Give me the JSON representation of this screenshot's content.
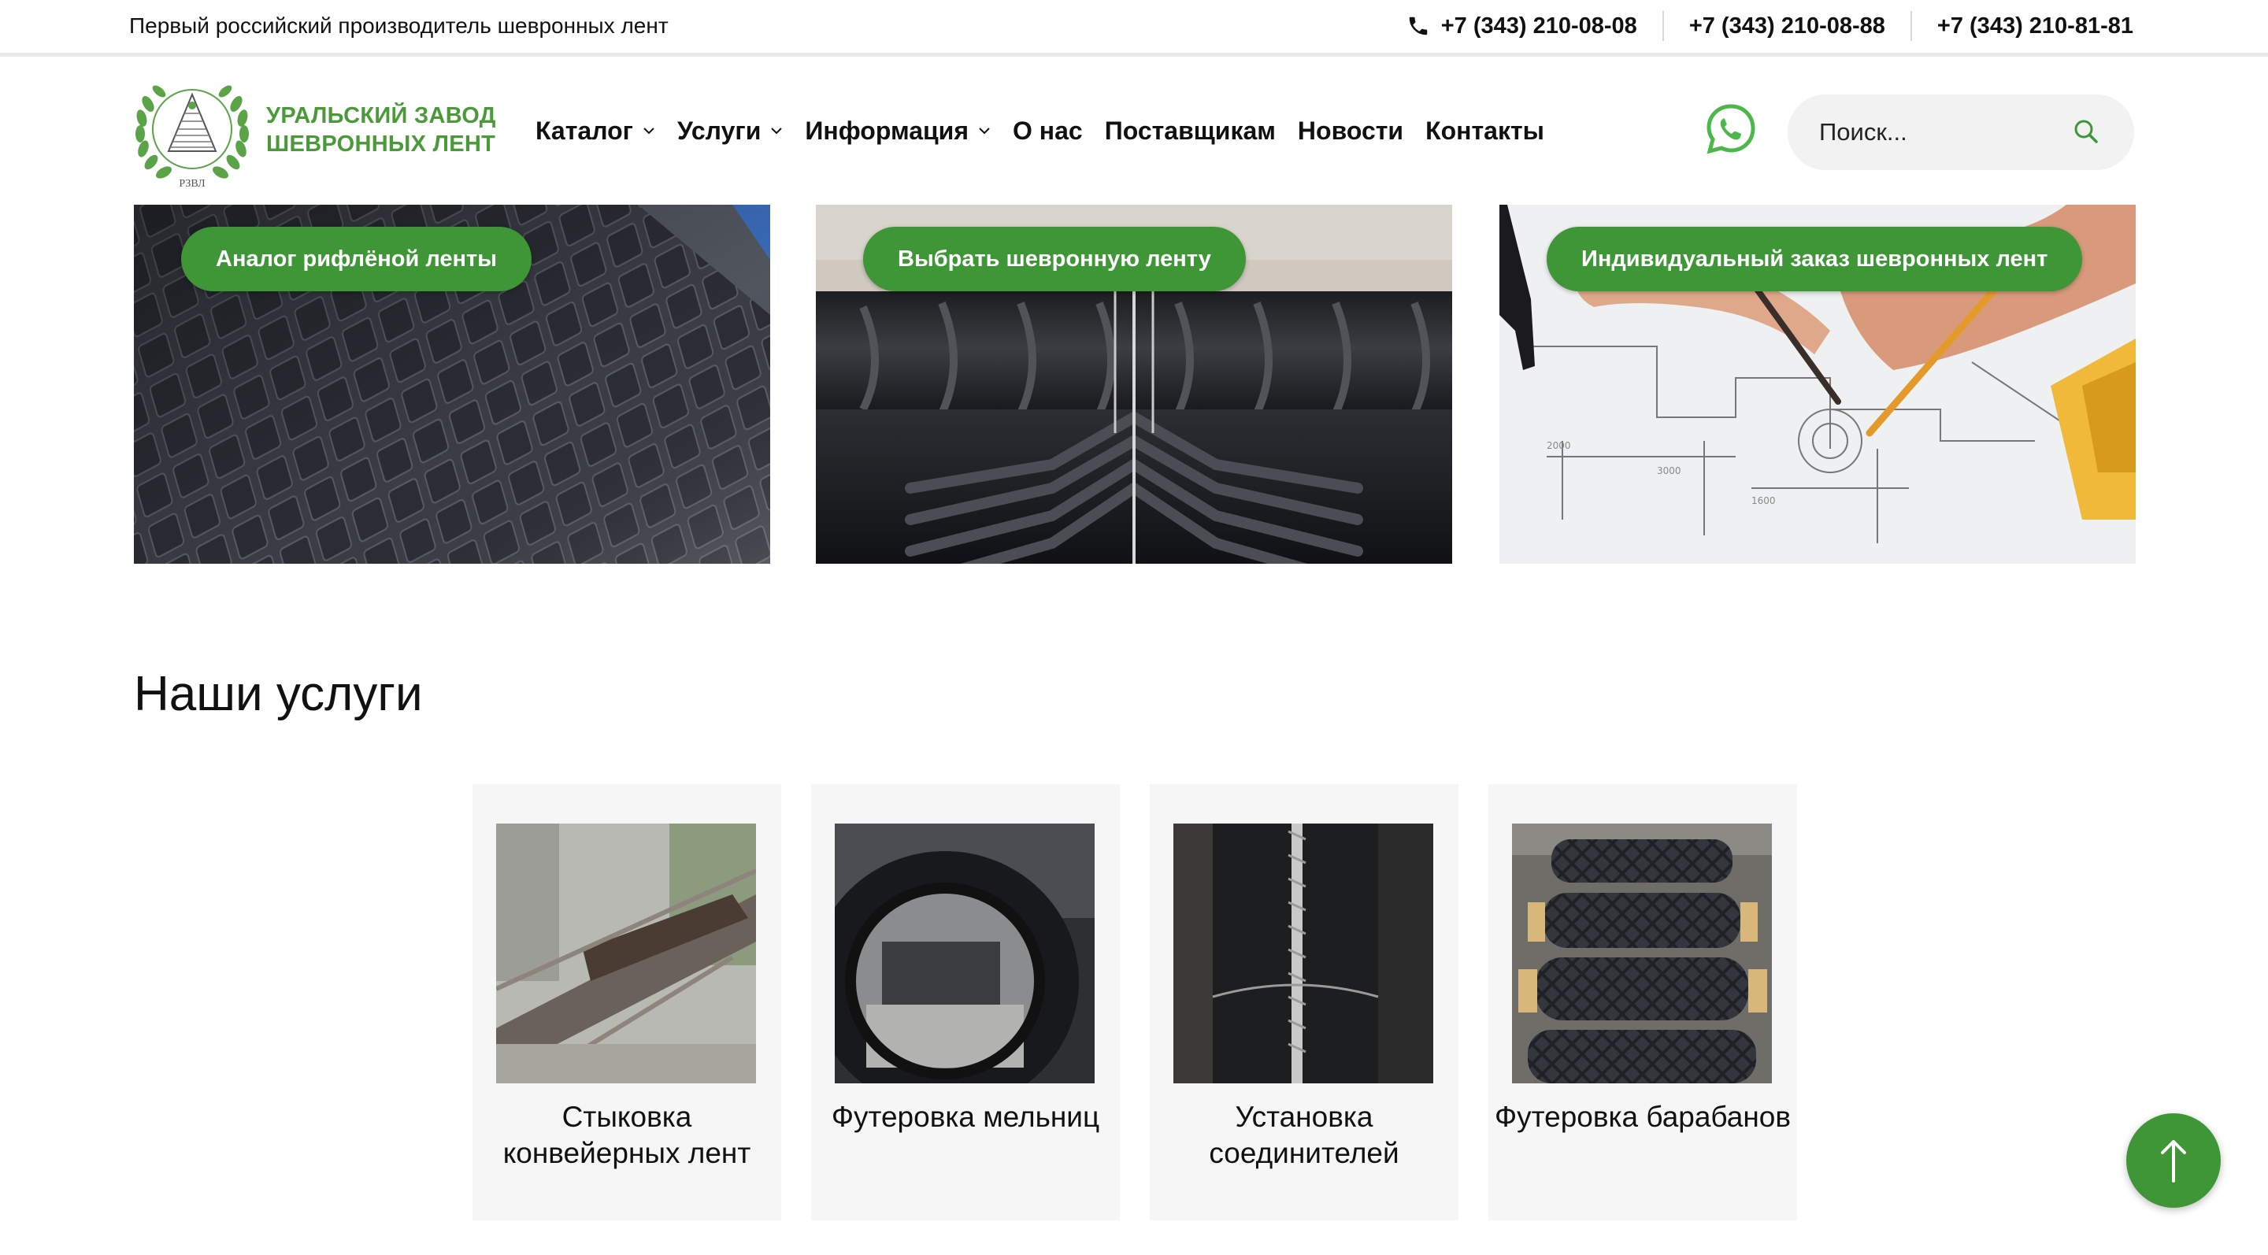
{
  "topbar": {
    "tagline": "Первый российский производитель шевронных лент",
    "phones": [
      "+7 (343) 210-08-08",
      "+7 (343) 210-08-88",
      "+7 (343) 210-81-81"
    ],
    "phone_icon": "phone-icon"
  },
  "brand": {
    "line1": "УРАЛЬСКИЙ ЗАВОД",
    "line2": "ШЕВРОННЫХ ЛЕНТ",
    "logo_monogram": "РЗВЛ",
    "color": "#4a9a3a"
  },
  "nav": {
    "items": [
      {
        "label": "Каталог",
        "has_dropdown": true
      },
      {
        "label": "Услуги",
        "has_dropdown": true
      },
      {
        "label": "Информация",
        "has_dropdown": true
      },
      {
        "label": "О нас",
        "has_dropdown": false
      },
      {
        "label": "Поставщикам",
        "has_dropdown": false
      },
      {
        "label": "Новости",
        "has_dropdown": false
      },
      {
        "label": "Контакты",
        "has_dropdown": false
      }
    ]
  },
  "search": {
    "placeholder": "Поиск...",
    "value": "",
    "icon": "search-icon"
  },
  "promos": [
    {
      "label": "Аналог рифлёной ленты",
      "image": "ribbed-rubber-belt-photo"
    },
    {
      "label": "Выбрать шевронную ленту",
      "image": "chevron-belt-photo"
    },
    {
      "label": "Индивидуальный заказ шевронных лент",
      "image": "drafting-blueprint-photo"
    }
  ],
  "services": {
    "title": "Наши услуги",
    "items": [
      {
        "label": "Стыковка конвейерных лент",
        "image": "conveyor-splicing-photo"
      },
      {
        "label": "Футеровка мельниц",
        "image": "mill-lining-photo"
      },
      {
        "label": "Установка соединителей",
        "image": "belt-fastener-photo"
      },
      {
        "label": "Футеровка барабанов",
        "image": "drum-lagging-photo"
      }
    ]
  },
  "colors": {
    "accent": "#3f9637",
    "text": "#111111",
    "card_bg": "#f6f6f6",
    "search_bg": "#f2f2f2"
  }
}
